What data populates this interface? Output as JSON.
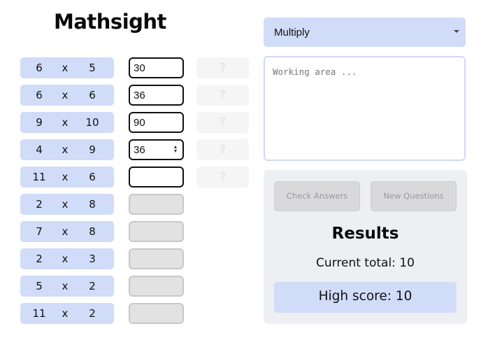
{
  "app": {
    "logo": "Mathsight"
  },
  "operation": {
    "selected": "Multiply"
  },
  "working_area": {
    "placeholder": "Working area ..."
  },
  "questions": [
    {
      "a": "6",
      "op": "x",
      "b": "5",
      "answer": "30",
      "mark": "?"
    },
    {
      "a": "6",
      "op": "x",
      "b": "6",
      "answer": "36",
      "mark": "?"
    },
    {
      "a": "9",
      "op": "x",
      "b": "10",
      "answer": "90",
      "mark": "?"
    },
    {
      "a": "4",
      "op": "x",
      "b": "9",
      "answer": "36",
      "mark": "?"
    },
    {
      "a": "11",
      "op": "x",
      "b": "6",
      "answer": "",
      "mark": "?"
    },
    {
      "a": "2",
      "op": "x",
      "b": "8",
      "answer": ""
    },
    {
      "a": "7",
      "op": "x",
      "b": "8",
      "answer": ""
    },
    {
      "a": "2",
      "op": "x",
      "b": "3",
      "answer": ""
    },
    {
      "a": "5",
      "op": "x",
      "b": "2",
      "answer": ""
    },
    {
      "a": "11",
      "op": "x",
      "b": "2",
      "answer": ""
    }
  ],
  "buttons": {
    "check": "Check Answers",
    "new": "New Questions"
  },
  "results": {
    "title": "Results",
    "current_total": "Current total: 10",
    "high_score": "High score: 10"
  }
}
